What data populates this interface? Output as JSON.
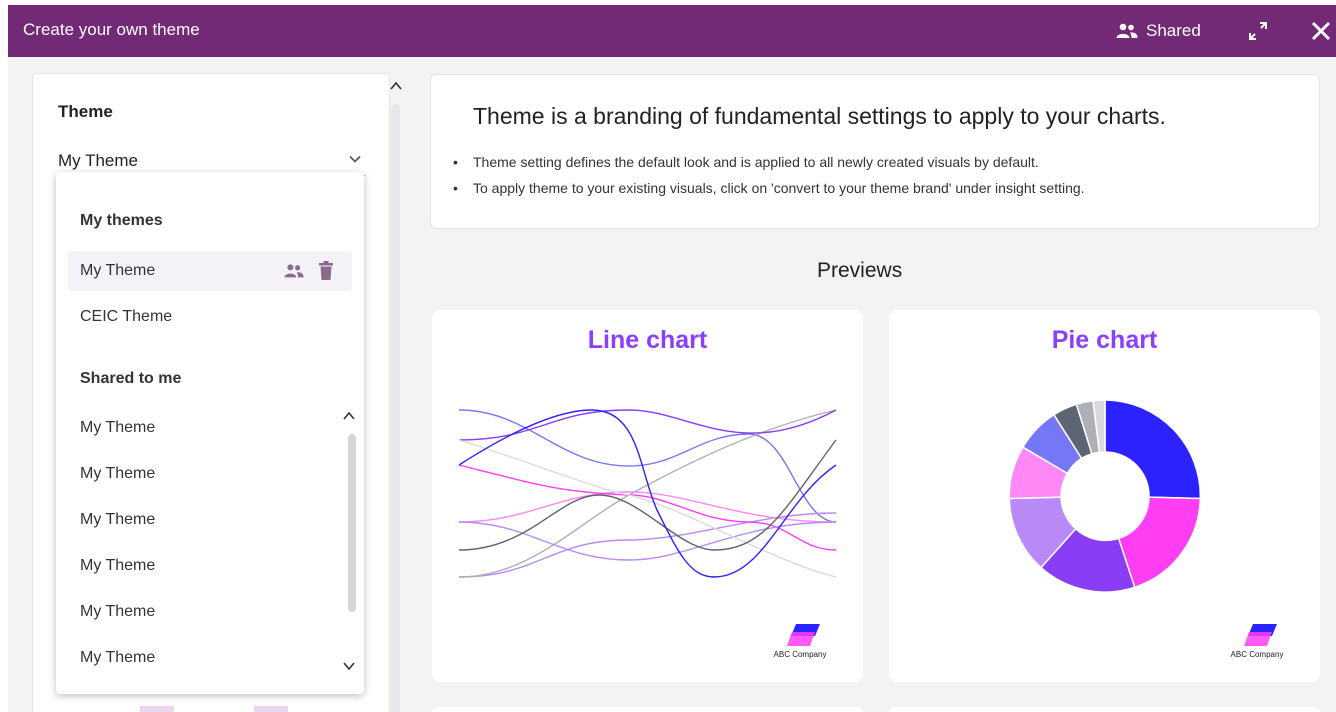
{
  "header": {
    "title": "Create your own theme",
    "shared_label": "Shared",
    "icons": {
      "shared": "people-icon",
      "expand": "expand-icon",
      "close": "close-icon"
    },
    "color": "#722a77"
  },
  "sidebar": {
    "theme_label": "Theme",
    "selected_theme": "My Theme",
    "dropdown": {
      "my_themes_heading": "My themes",
      "my_themes": [
        {
          "label": "My Theme",
          "selected": true,
          "icons": [
            "people-icon",
            "trash-icon"
          ]
        },
        {
          "label": "CEIC Theme"
        }
      ],
      "shared_heading": "Shared to me",
      "shared_items": [
        "My Theme",
        "My Theme",
        "My Theme",
        "My Theme",
        "My Theme",
        "My Theme"
      ]
    }
  },
  "info": {
    "heading": "Theme is a branding of fundamental settings to apply to your charts.",
    "bullets": [
      "Theme setting defines the default look and is applied to all newly created visuals by default.",
      "To apply theme to your existing visuals, click on 'convert to your theme brand' under insight setting."
    ]
  },
  "previews": {
    "heading": "Previews",
    "cards": [
      {
        "title": "Line chart",
        "brand": "ABC Company"
      },
      {
        "title": "Pie chart",
        "brand": "ABC Company"
      }
    ]
  },
  "colors": {
    "accent": "#8a3ffc",
    "series": [
      "#2b22ff",
      "#ff3df2",
      "#8b3cf5",
      "#b889f7",
      "#ff88f6",
      "#7677f7",
      "#5e6572",
      "#aeb0b6",
      "#d9dadc"
    ]
  }
}
